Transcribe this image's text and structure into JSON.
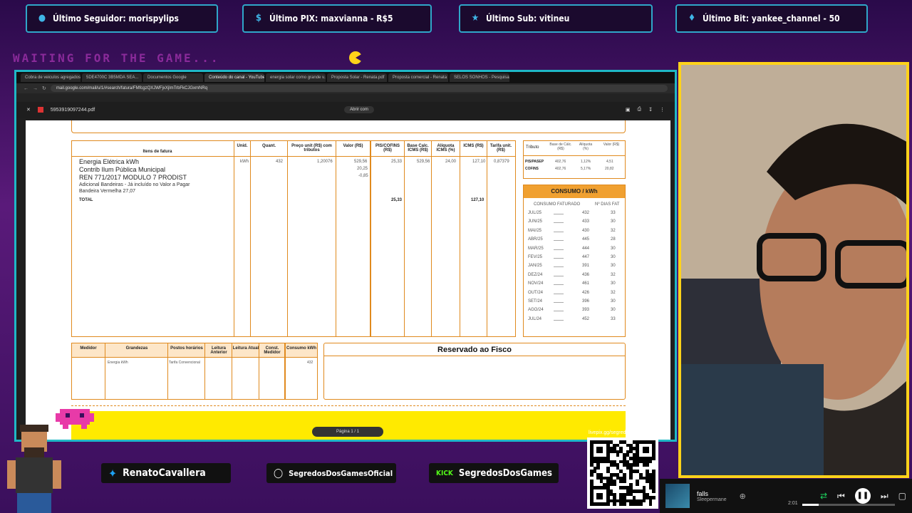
{
  "alerts": {
    "follower": "Último Seguidor: morispylips",
    "pix": "Último PIX: maxvianna - R$5",
    "sub": "Último Sub: vitineu",
    "bit": "Último Bit: yankee_channel - 50"
  },
  "waiting_text": "WAITING FOR THE GAME...",
  "browser": {
    "tabs": [
      "Cobra de veiculos agregados",
      "5DE4700C 3B5MDA SEA...",
      "Documentos Google",
      "Conteúdo do canal - YouTube Studio",
      "energia solar como grande v...",
      "Proposta Solar - Renata.pdf",
      "Proposta comercial - Renata",
      "SELOS SONHOS - Pesquisa"
    ],
    "url": "mail.google.com/mail/u/1/#search/fatura/FMfcgzQXJWFjxXjlmTrbFkCJGxmNRq"
  },
  "pdf": {
    "filename": "5953919097244.pdf",
    "zoom": "Abrir com",
    "items_header": "Itens de fatura",
    "columns": [
      "Unid.",
      "Quant.",
      "Preço unit (R$) com tributos",
      "Valor (R$)",
      "PIS/COFINS (R$)",
      "Base Calc. ICMS (R$)",
      "Alíquota ICMS (%)",
      "ICMS (R$)",
      "Tarifa unit. (R$)"
    ],
    "items": [
      "Energia Elétrica kWh",
      "Contrib Ilum Pública Municipal",
      "REN 771/2017 MODULO 7 PRODIST",
      "Adicional Bandeiras - Já incluído no Valor a Pagar",
      "Bandeira Vermelha 27,07"
    ],
    "total_label": "TOTAL",
    "row_values": {
      "unid": "kWh",
      "quant": "432",
      "preco": "1,20076",
      "valor": "529,56",
      "valor2": "20,25",
      "valor3": "-0,85",
      "pis": "25,33",
      "base": "529,56",
      "aliq": "24,00",
      "icms": "127,10",
      "tarifa": "0,87379"
    },
    "totals": {
      "pis": "25,33",
      "icms": "127,10"
    },
    "tributo_header": [
      "Tributo",
      "Base de Cálc. (R$)",
      "Alíquota (%)",
      "Valor (R$)"
    ],
    "tributos": [
      {
        "name": "PIS/PASEP",
        "base": "402,76",
        "aliq": "1,12%",
        "valor": "4,51"
      },
      {
        "name": "COFINS",
        "base": "402,76",
        "aliq": "5,17%",
        "valor": "20,82"
      }
    ],
    "consumo_title": "CONSUMO / kWh",
    "consumo_cols": [
      "CONSUMO FATURADO",
      "Nº DIAS FAT"
    ],
    "consumo": [
      {
        "mes": "JUL/25",
        "kwh": "432",
        "dias": "33"
      },
      {
        "mes": "JUN/25",
        "kwh": "433",
        "dias": "30"
      },
      {
        "mes": "MAI/25",
        "kwh": "430",
        "dias": "32"
      },
      {
        "mes": "ABR/25",
        "kwh": "445",
        "dias": "28"
      },
      {
        "mes": "MAR/25",
        "kwh": "444",
        "dias": "30"
      },
      {
        "mes": "FEV/25",
        "kwh": "447",
        "dias": "30"
      },
      {
        "mes": "JAN/25",
        "kwh": "391",
        "dias": "30"
      },
      {
        "mes": "DEZ/24",
        "kwh": "436",
        "dias": "32"
      },
      {
        "mes": "NOV/24",
        "kwh": "461",
        "dias": "30"
      },
      {
        "mes": "OUT/24",
        "kwh": "426",
        "dias": "32"
      },
      {
        "mes": "SET/24",
        "kwh": "396",
        "dias": "30"
      },
      {
        "mes": "AGO/24",
        "kwh": "393",
        "dias": "30"
      },
      {
        "mes": "JUL/24",
        "kwh": "452",
        "dias": "33"
      }
    ],
    "medidor_cols": [
      "Medidor",
      "Grandezas",
      "Postos horários",
      "Leitura Anterior",
      "Leitura Atual",
      "Const. Medidor",
      "Consumo kWh"
    ],
    "medidor_row": {
      "grandeza": "Energia kWh",
      "posto": "Tarifa Convencional",
      "consumo": "432"
    },
    "fisco_title": "Reservado ao Fisco",
    "pager": "Página 1 / 1"
  },
  "social": {
    "twitter": "RenatoCavallera",
    "instagram": "SegredosDosGamesOficial",
    "kick_label": "KICK",
    "kick": "SegredosDosGames",
    "qr_label": "livepix.gg/segredosdosgames"
  },
  "player": {
    "song": "falls",
    "artist": "Sleepermane",
    "time": "2:01",
    "progress": 0.18
  }
}
